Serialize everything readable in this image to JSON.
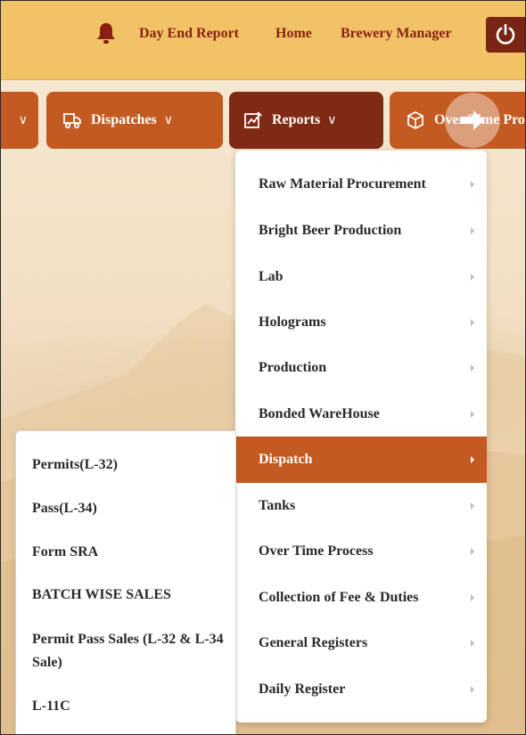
{
  "header": {
    "links": [
      "Day End Report",
      "Home",
      "Brewery Manager"
    ],
    "bell_icon": "bell-icon",
    "power_icon": "power-icon",
    "background_color": "#f2c366",
    "link_color": "#8b1f14"
  },
  "nav": {
    "items": [
      {
        "label": "Dispatches",
        "icon": "truck-icon"
      },
      {
        "label": "Reports",
        "icon": "chart-edit-icon"
      },
      {
        "label": "Over Time Process",
        "icon": "cube-icon"
      }
    ],
    "button_color": "#c25a22",
    "active_color": "#7f2a14",
    "scroll_icon": "arrow-right-icon"
  },
  "reports_menu": {
    "items": [
      "Raw Material Procurement",
      "Bright Beer Production",
      "Lab",
      "Holograms",
      "Production",
      "Bonded WareHouse",
      "Dispatch",
      "Tanks",
      "Over Time Process",
      "Collection of Fee & Duties",
      "General Registers",
      "Daily Register"
    ],
    "selected": "Dispatch"
  },
  "dispatch_submenu": {
    "items": [
      "Permits(L-32)",
      "Pass(L-34)",
      "Form SRA",
      "BATCH WISE SALES",
      "Permit Pass Sales (L-32 & L-34 Sale)",
      "L-11C"
    ]
  }
}
